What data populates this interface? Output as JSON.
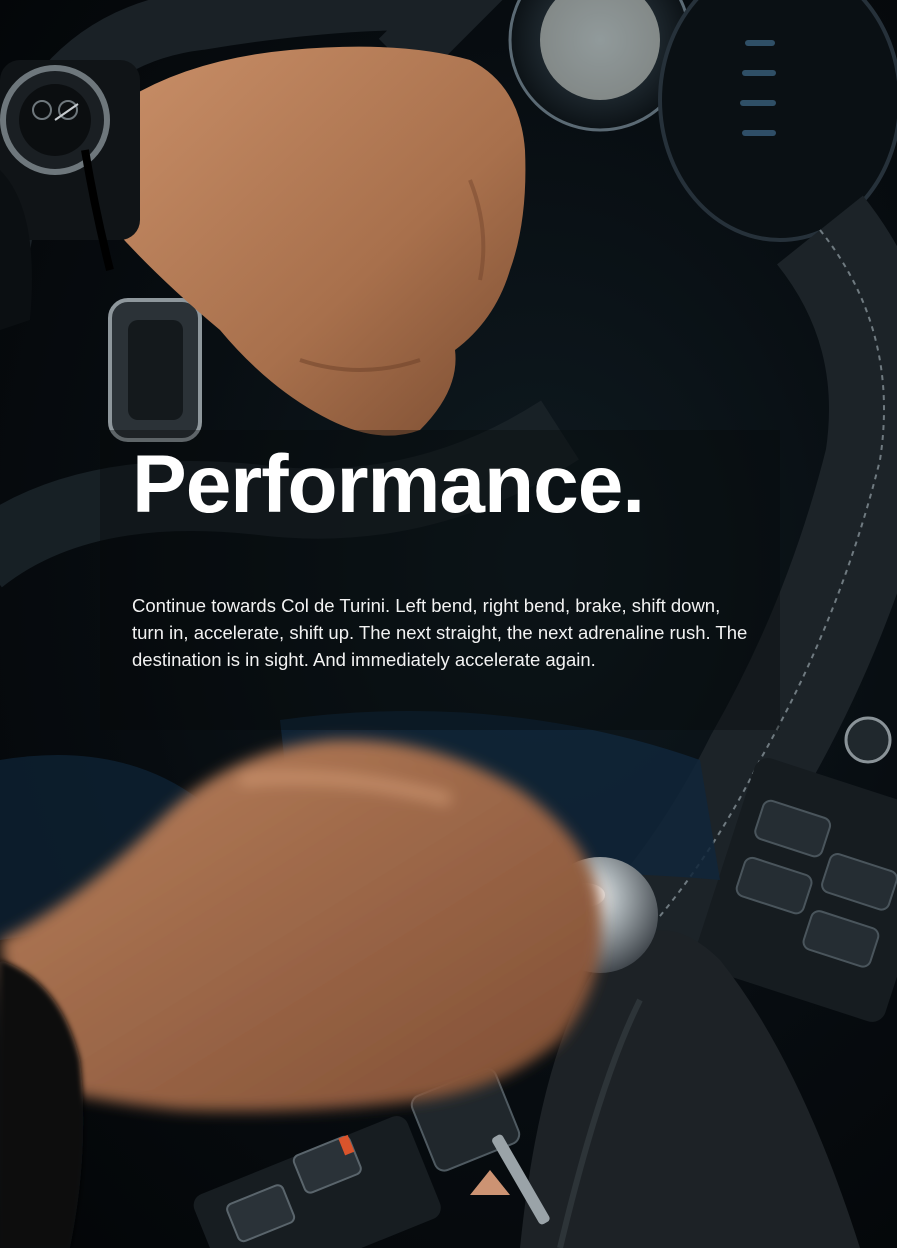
{
  "headline": "Performance.",
  "body_text": "Continue towards Col de Turini. Left bend, right bend, brake, shift down, turn in, accelerate, shift up. The next straight, the next adrenaline rush. The destination is in sight. And immediately accelerate again.",
  "colors": {
    "text": "#ffffff",
    "background": "#070c10",
    "skin": "#b47a55"
  }
}
